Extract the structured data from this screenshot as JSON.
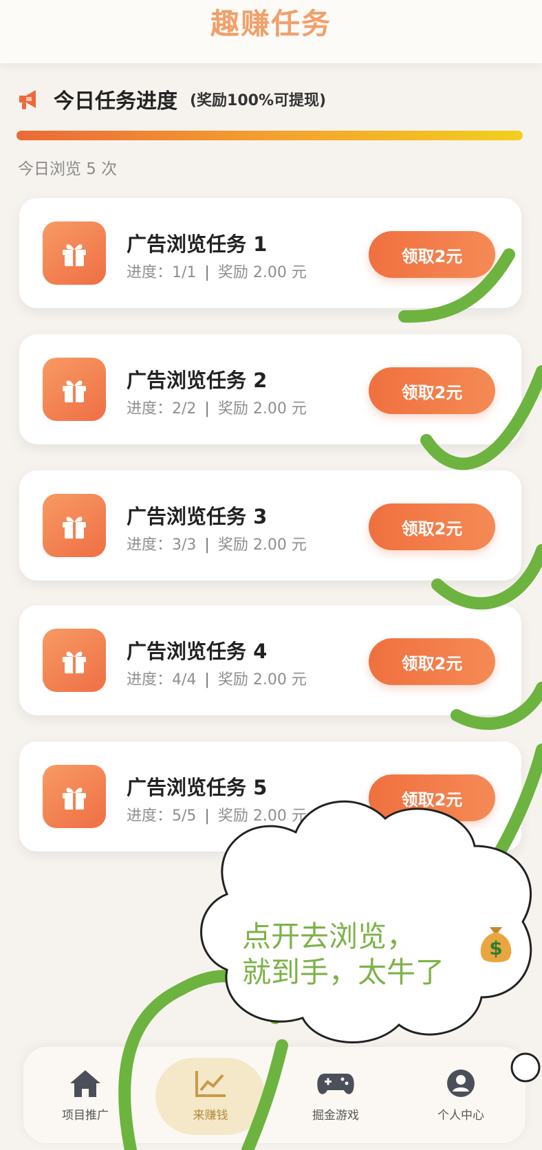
{
  "header": {
    "title": "趣赚任务"
  },
  "progress": {
    "title": "今日任务进度",
    "note": "(奖励100%可提现)",
    "fill": 1.0,
    "views_text": "今日浏览 5 次"
  },
  "tasks": [
    {
      "title": "广告浏览任务 1",
      "progress": "进度：1/1",
      "sep": "|",
      "reward": "奖励 2.00 元",
      "button": "领取2元"
    },
    {
      "title": "广告浏览任务 2",
      "progress": "进度：2/2",
      "sep": "|",
      "reward": "奖励 2.00 元",
      "button": "领取2元"
    },
    {
      "title": "广告浏览任务 3",
      "progress": "进度：3/3",
      "sep": "|",
      "reward": "奖励 2.00 元",
      "button": "领取2元"
    },
    {
      "title": "广告浏览任务 4",
      "progress": "进度：4/4",
      "sep": "|",
      "reward": "奖励 2.00 元",
      "button": "领取2元"
    },
    {
      "title": "广告浏览任务 5",
      "progress": "进度：5/5",
      "sep": "|",
      "reward": "奖励 2.00 元",
      "button": "领取2元"
    }
  ],
  "annotation": {
    "line1": "点开去浏览，",
    "line2": "就到手，太牛了",
    "money_symbol": "$"
  },
  "tabbar": {
    "items": [
      {
        "label": "项目推广",
        "icon": "home-icon"
      },
      {
        "label": "来赚钱",
        "icon": "chart-icon",
        "active": true
      },
      {
        "label": "掘金游戏",
        "icon": "gamepad-icon"
      },
      {
        "label": "个人中心",
        "icon": "user-icon"
      }
    ]
  },
  "colors": {
    "accent": "#f0703f",
    "header_title": "#f0a06b",
    "annotation_green": "#6db33f"
  }
}
